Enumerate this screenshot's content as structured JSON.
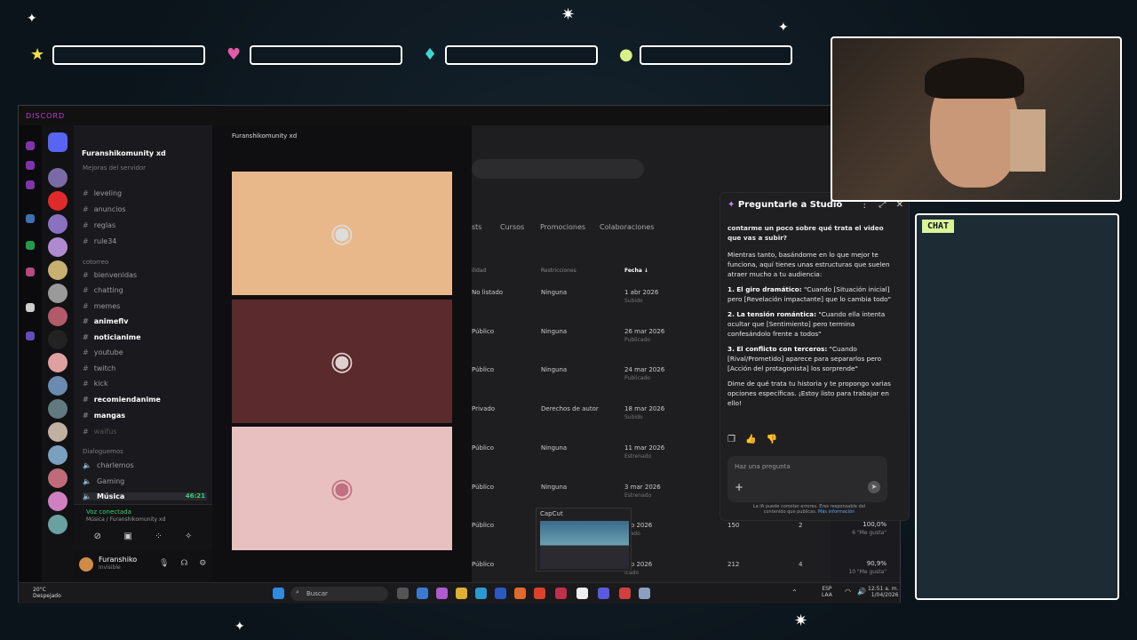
{
  "discord": {
    "app_name": "DISCORD",
    "server_name": "Furanshikomunity xd",
    "boost_hint": "Mejoras del servidor",
    "channels_top": [
      "leveling",
      "anuncios",
      "reglas",
      "rule34"
    ],
    "category_cotorreo": "cotorreo",
    "channels_cotorreo": [
      {
        "name": "bienvenidas",
        "bold": false
      },
      {
        "name": "chatting",
        "bold": false
      },
      {
        "name": "memes",
        "bold": false
      },
      {
        "name": "animeflv",
        "bold": true
      },
      {
        "name": "noticianime",
        "bold": true
      },
      {
        "name": "youtube",
        "bold": false
      },
      {
        "name": "twitch",
        "bold": false
      },
      {
        "name": "kick",
        "bold": false
      },
      {
        "name": "recomiendanime",
        "bold": true
      },
      {
        "name": "mangas",
        "bold": true
      },
      {
        "name": "waifus",
        "bold": false
      }
    ],
    "category_voice": "Dialoguemos",
    "voice_channels": [
      "charlemos",
      "Gaming",
      "Música"
    ],
    "voice_time": "46:21",
    "voice_status": "Voz conectada",
    "voice_location": "Música / Furanshikomunity xd",
    "user_name": "Furanshiko",
    "user_status": "Invisible",
    "stream_header": "Furanshikomunity xd"
  },
  "youtube": {
    "tabs": [
      "sts",
      "Cursos",
      "Promociones",
      "Colaboraciones"
    ],
    "columns": [
      "ilidad",
      "Restricciones",
      "Fecha"
    ],
    "rows": [
      {
        "vis": "No listado",
        "restr": "Ninguna",
        "date": "1 abr 2026",
        "state": "Subido",
        "views": "",
        "comments": "",
        "pct": "",
        "likes": ""
      },
      {
        "vis": "Público",
        "restr": "Ninguna",
        "date": "26 mar 2026",
        "state": "Publicado",
        "views": "",
        "comments": "",
        "pct": "",
        "likes": ""
      },
      {
        "vis": "Público",
        "restr": "Ninguna",
        "date": "24 mar 2026",
        "state": "Publicado",
        "views": "",
        "comments": "",
        "pct": "",
        "likes": ""
      },
      {
        "vis": "Privado",
        "restr": "Derechos de autor",
        "date": "18 mar 2026",
        "state": "Subido",
        "views": "",
        "comments": "",
        "pct": "",
        "likes": ""
      },
      {
        "vis": "Público",
        "restr": "Ninguna",
        "date": "11 mar 2026",
        "state": "Estrenado",
        "views": "",
        "comments": "",
        "pct": "",
        "likes": ""
      },
      {
        "vis": "Público",
        "restr": "Ninguna",
        "date": "3 mar 2026",
        "state": "Estrenado",
        "views": "",
        "comments": "",
        "pct": "",
        "likes": ""
      },
      {
        "vis": "Público",
        "restr": "",
        "date": "feb 2026",
        "state": "licado",
        "views": "150",
        "comments": "2",
        "pct": "100,0%",
        "likes": "6 \"Me gusta\""
      },
      {
        "vis": "Público",
        "restr": "",
        "date": "feb 2026",
        "state": "icado",
        "views": "212",
        "comments": "4",
        "pct": "90,9%",
        "likes": "10 \"Me gusta\""
      }
    ],
    "capcut_label": "CapCut"
  },
  "studio": {
    "title": "Preguntarle a Studio",
    "question": "contarme un poco sobre qué trata el video que vas a subir?",
    "intro": "Mientras tanto, basándome en lo que mejor te funciona, aquí tienes unas estructuras que suelen atraer mucho a tu audiencia:",
    "items": [
      {
        "n": "1.",
        "head": "El giro dramático:",
        "body": "\"Cuando [Situación inicial] pero [Revelación impactante] que lo cambia todo\""
      },
      {
        "n": "2.",
        "head": "La tensión romántica:",
        "body": "\"Cuando ella intenta ocultar que [Sentimiento] pero termina confesándolo frente a todos\""
      },
      {
        "n": "3.",
        "head": "El conflicto con terceros:",
        "body": "\"Cuando [Rival/Prometido] aparece para separarlos pero [Acción del protagonista] los sorprende\""
      }
    ],
    "outro": "Dime de qué trata tu historia y te propongo varias opciones específicas. ¡Estoy listo para trabajar en ello!",
    "input_placeholder": "Haz una pregunta",
    "disclaimer": "La IA puede cometer errores. Eres responsable del contenido que publicas.",
    "more_info": "Más información"
  },
  "taskbar": {
    "weather_temp": "20°C",
    "weather_desc": "Despejado",
    "search_placeholder": "Buscar",
    "lang": "ESP",
    "lang_sub": "LAA",
    "time": "12:51 a. m.",
    "date": "1/04/2026"
  },
  "overlay": {
    "chat_label": "CHAT"
  },
  "colors": {
    "accent": "#c53ad8",
    "studio_bg": "#1f1f21",
    "chat_bg": "#1c2b34",
    "chat_tag": "#d9f59a"
  }
}
